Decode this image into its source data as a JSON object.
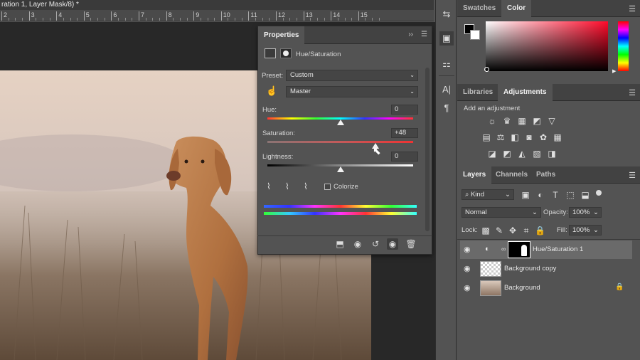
{
  "document": {
    "tab_title": "ration 1, Layer Mask/8) *",
    "ruler_ticks": [
      "2",
      "3",
      "4",
      "5",
      "6",
      "7",
      "8",
      "9",
      "10",
      "11",
      "12",
      "13",
      "14",
      "15"
    ]
  },
  "properties": {
    "tab_label": "Properties",
    "title": "Hue/Saturation",
    "preset_label": "Preset:",
    "preset_value": "Custom",
    "channel_value": "Master",
    "hue_label": "Hue:",
    "hue_value": "0",
    "saturation_label": "Saturation:",
    "saturation_value": "+48",
    "lightness_label": "Lightness:",
    "lightness_value": "0",
    "colorize_label": "Colorize",
    "colorize_checked": false,
    "hue_level": 0.5,
    "saturation_level": 0.74,
    "lightness_level": 0.5
  },
  "right_panels": {
    "top_tabs": [
      "Swatches",
      "Color"
    ],
    "mid_tabs": [
      "Libraries",
      "Adjustments"
    ],
    "add_adjustment": "Add an adjustment",
    "layers_tabs": [
      "Layers",
      "Channels",
      "Paths"
    ],
    "kind_label": "Kind",
    "blend_mode": "Normal",
    "opacity_label": "Opacity:",
    "opacity_value": "100%",
    "lock_label": "Lock:",
    "fill_label": "Fill:",
    "fill_value": "100%",
    "layers": [
      {
        "name": "Hue/Saturation 1"
      },
      {
        "name": "Background copy"
      },
      {
        "name": "Background"
      }
    ]
  },
  "colors": {
    "panel": "#535353",
    "header": "#424242",
    "canvas_bg": "#282828",
    "color_picker_hue": "#ff0a2a"
  }
}
